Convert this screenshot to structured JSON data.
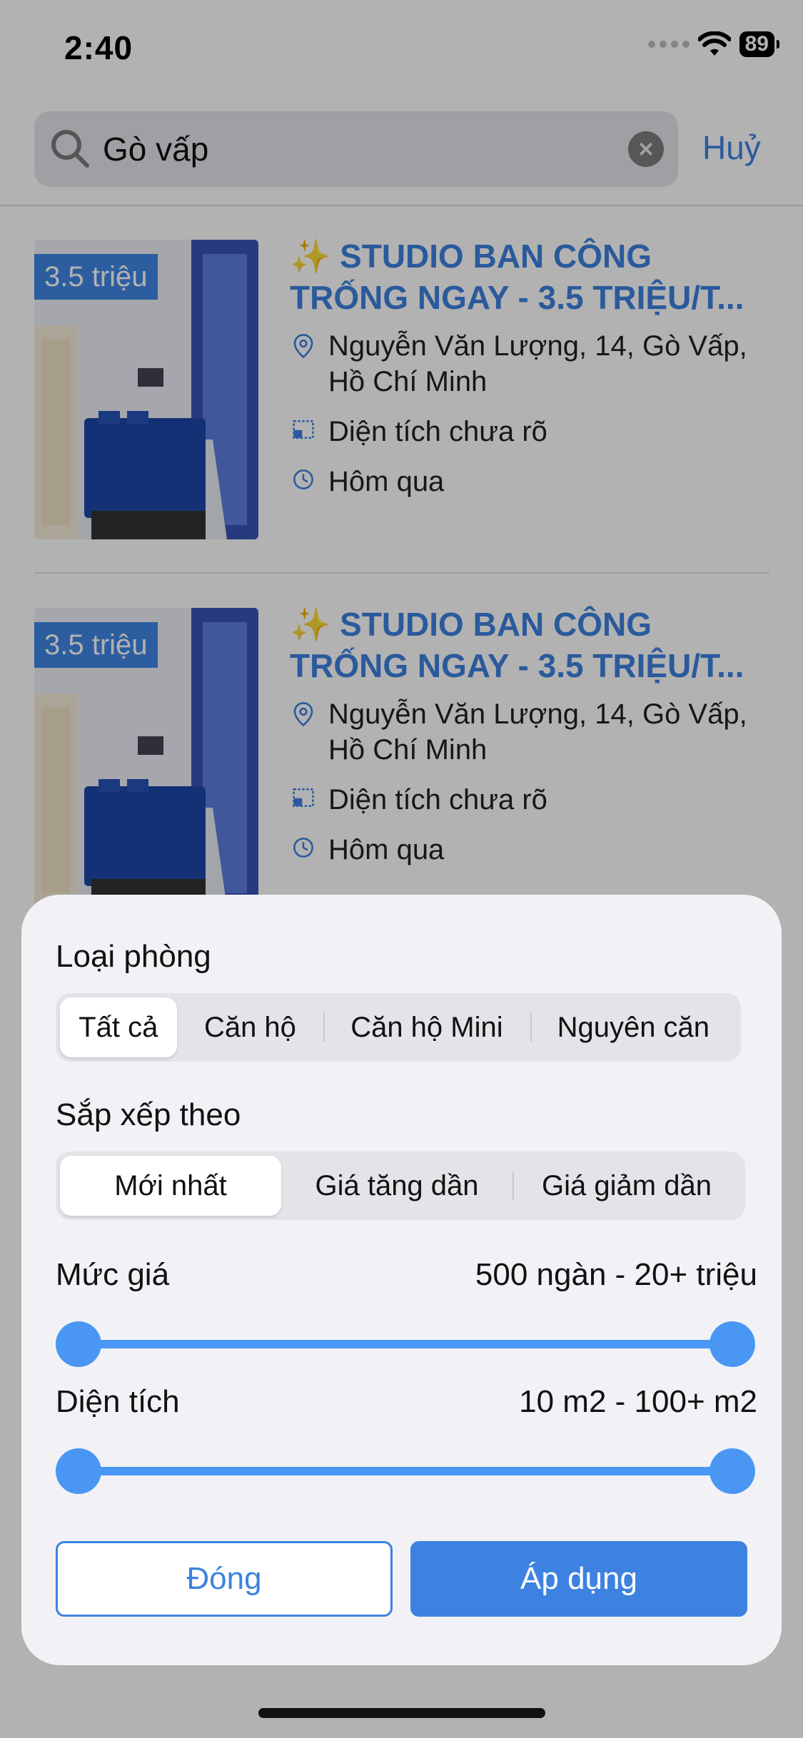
{
  "status_bar": {
    "time": "2:40",
    "battery": "89"
  },
  "search": {
    "value": "Gò vấp",
    "cancel_label": "Huỷ"
  },
  "listings": [
    {
      "price": "3.5 triệu",
      "title_line1": "✨ STUDIO BAN CÔNG",
      "title_line2": "TRỐNG NGAY - 3.5 TRIỆU/T...",
      "address": "Nguyễn Văn Lượng, 14, Gò Vấp, Hồ Chí Minh",
      "area": "Diện tích chưa rõ",
      "time": "Hôm qua"
    },
    {
      "price": "3.5 triệu",
      "title_line1": "✨ STUDIO BAN CÔNG",
      "title_line2": "TRỐNG NGAY - 3.5 TRIỆU/T...",
      "address": "Nguyễn Văn Lượng, 14, Gò Vấp, Hồ Chí Minh",
      "area": "Diện tích chưa rõ",
      "time": "Hôm qua"
    }
  ],
  "filter": {
    "room_type": {
      "label": "Loại phòng",
      "options": [
        "Tất cả",
        "Căn hộ",
        "Căn hộ Mini",
        "Nguyên căn"
      ],
      "selected": "Tất cả"
    },
    "sort": {
      "label": "Sắp xếp theo",
      "options": [
        "Mới nhất",
        "Giá tăng dần",
        "Giá giảm dần"
      ],
      "selected": "Mới nhất"
    },
    "price": {
      "label": "Mức giá",
      "value": "500 ngàn - 20+ triệu",
      "min_fraction": 0.0,
      "max_fraction": 1.0
    },
    "area": {
      "label": "Diện tích",
      "value": "10 m2 - 100+ m2",
      "min_fraction": 0.0,
      "max_fraction": 1.0
    },
    "close_label": "Đóng",
    "apply_label": "Áp dụng"
  },
  "colors": {
    "accent": "#3d82e0",
    "slider": "#4a97f3",
    "sheet_bg": "#f2f2f6"
  }
}
